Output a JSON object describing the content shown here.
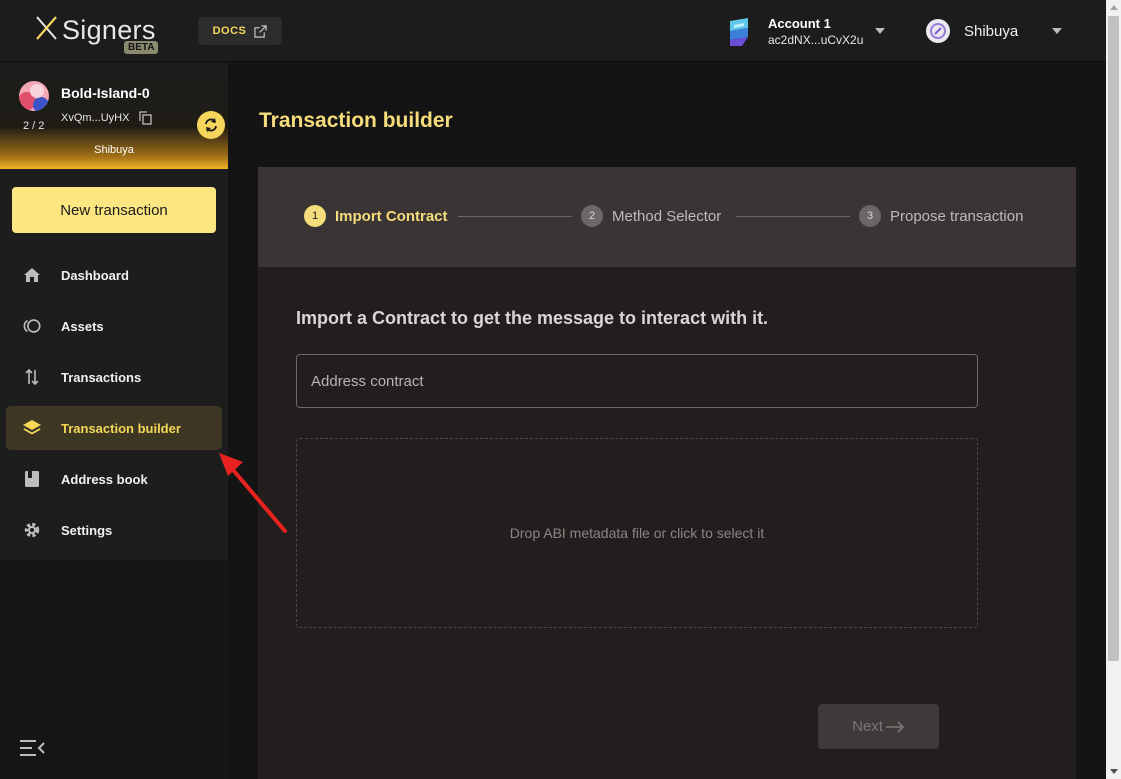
{
  "header": {
    "logo_text": "Signers",
    "beta_badge": "BETA",
    "docs_label": "DOCS",
    "account": {
      "name": "Account 1",
      "address": "ac2dNX...uCvX2u"
    },
    "network": {
      "name": "Shibuya"
    }
  },
  "sidebar": {
    "safe": {
      "name": "Bold-Island-0",
      "address": "XvQm...UyHX",
      "threshold": "2 / 2",
      "network": "Shibuya"
    },
    "new_transaction_label": "New transaction",
    "items": [
      {
        "label": "Dashboard",
        "icon": "home-icon",
        "active": false
      },
      {
        "label": "Assets",
        "icon": "assets-icon",
        "active": false
      },
      {
        "label": "Transactions",
        "icon": "transfer-arrows-icon",
        "active": false
      },
      {
        "label": "Transaction builder",
        "icon": "layers-icon",
        "active": true
      },
      {
        "label": "Address book",
        "icon": "book-icon",
        "active": false
      },
      {
        "label": "Settings",
        "icon": "gear-icon",
        "active": false
      }
    ]
  },
  "main": {
    "title": "Transaction builder",
    "steps": [
      {
        "number": "1",
        "label": "Import Contract",
        "active": true
      },
      {
        "number": "2",
        "label": "Method Selector",
        "active": false
      },
      {
        "number": "3",
        "label": "Propose transaction",
        "active": false
      }
    ],
    "heading": "Import a Contract to get the message to interact with it.",
    "address_placeholder": "Address contract",
    "dropzone_text": "Drop ABI metadata file or click to select it",
    "next_label": "Next"
  },
  "colors": {
    "accent": "#f6dd7c",
    "button_yellow": "#fbe682",
    "active_nav_bg": "#3c3622",
    "annotation_arrow": "#e8231f"
  }
}
